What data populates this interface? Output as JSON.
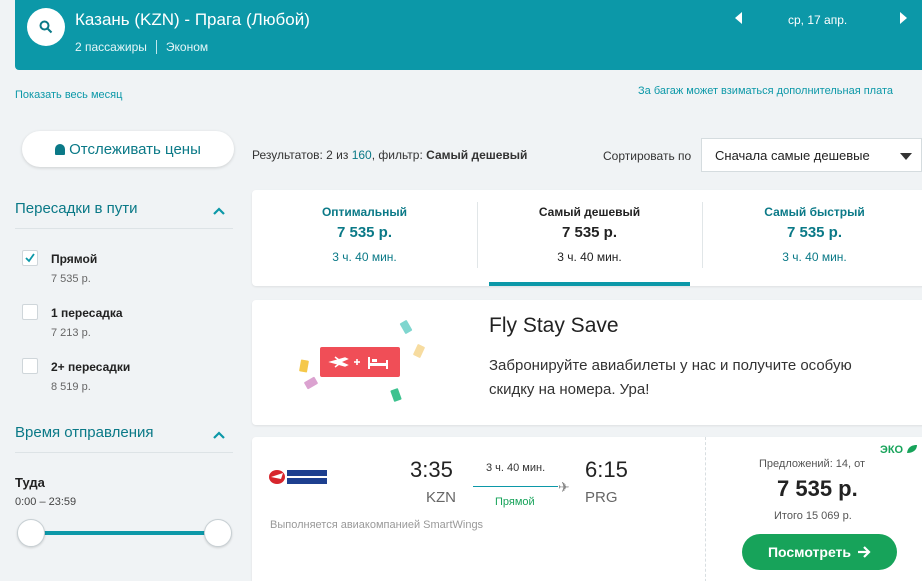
{
  "search": {
    "route": "Казань (KZN) - Прага (Любой)",
    "passengers": "2 пассажиры",
    "cabin": "Эконом",
    "date": "ср, 17 апр."
  },
  "links": {
    "show_month": "Показать весь месяц",
    "baggage_note": "За багаж может взиматься дополнительная плата"
  },
  "track_button": "Отслеживать цены",
  "filters": {
    "stops_title": "Пересадки в пути",
    "stops": [
      {
        "label": "Прямой",
        "price": "7 535 р.",
        "checked": true
      },
      {
        "label": "1 пересадка",
        "price": "7 213 р.",
        "checked": false
      },
      {
        "label": "2+ пересадки",
        "price": "8 519 р.",
        "checked": false
      }
    ],
    "departure_title": "Время отправления",
    "direction": "Туда",
    "range": "0:00 – 23:59"
  },
  "results": {
    "prefix": "Результатов: 2 из ",
    "total": "160",
    "filter_text": ", фильтр: ",
    "filter_value": "Самый дешевый",
    "sort_label": "Сортировать по",
    "sort_value": "Сначала самые дешевые"
  },
  "tabs": [
    {
      "title": "Оптимальный",
      "price": "7 535 р.",
      "duration": "3 ч. 40 мин."
    },
    {
      "title": "Самый дешевый",
      "price": "7 535 р.",
      "duration": "3 ч. 40 мин."
    },
    {
      "title": "Самый быстрый",
      "price": "7 535 р.",
      "duration": "3 ч. 40 мин."
    }
  ],
  "promo": {
    "title": "Fly Stay Save",
    "text": "Забронируйте авиабилеты у нас и получите особую скидку на номера. Ура!"
  },
  "flight": {
    "airline_logo_text": "CZECH AIRLINES",
    "dep_time": "3:35",
    "dep_code": "KZN",
    "arr_time": "6:15",
    "arr_code": "PRG",
    "duration": "3 ч. 40 мин.",
    "stops": "Прямой",
    "operated_by": "Выполняется авиакомпанией SmartWings",
    "eco": "ЭКО",
    "offers": "Предложений: 14, от",
    "price": "7 535 р.",
    "total": "Итого 15 069 р.",
    "view_button": "Посмотреть"
  },
  "colors": {
    "brand": "#0c98a8",
    "green": "#17a35a",
    "promo_red": "#f04e57"
  }
}
